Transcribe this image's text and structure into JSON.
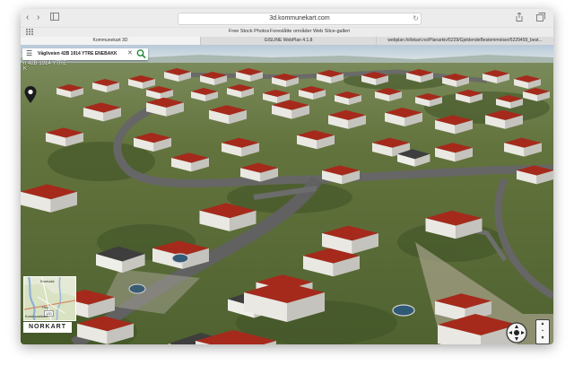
{
  "browser": {
    "url": "3d.kommunekart.com",
    "nav_back": "‹",
    "nav_forward": "›",
    "reload": "↻"
  },
  "bookmarks": [
    "Free Stock Photos",
    "Foreslåtte områder",
    "Web Slice-galleri"
  ],
  "tabs": [
    {
      "label": "Kommunekart 3D",
      "active": true
    },
    {
      "label": "GISLINE WebPlan 4.1.8",
      "active": false
    },
    {
      "label": "webplan.follokart.no/Planarkiv/5229/GjeldendeBestemmelser/5229459_best...",
      "active": false
    }
  ],
  "map": {
    "search_query": "Vågliveien 42B  1914 YTRE ENEBAKK",
    "ghost_label": "n 42B  1914 YTRE",
    "ghost_label_2": "K",
    "minimap": {
      "place": "Enebakk",
      "road_label": "Hey",
      "badge": "120",
      "attribution": "Kommunekart"
    },
    "logo": "NORKART"
  },
  "colors": {
    "roof": "#a0281b",
    "grass": "#5f7038",
    "road": "#646464"
  }
}
